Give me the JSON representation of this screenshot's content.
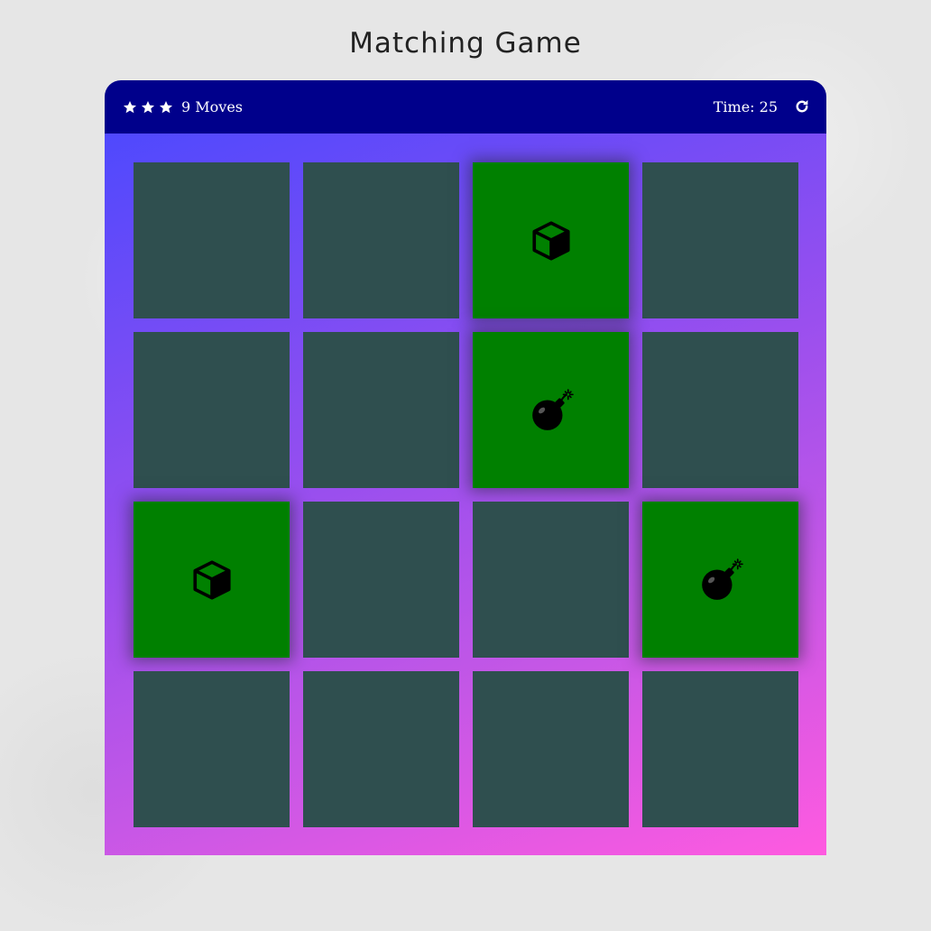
{
  "title": "Matching Game",
  "score_panel": {
    "stars": [
      "star-icon",
      "star-icon",
      "star-icon"
    ],
    "moves_text": "9 Moves",
    "timer_text": "Time: 25",
    "restart_icon": "restart-icon"
  },
  "deck": {
    "rows": 4,
    "columns": 4,
    "cards": [
      {
        "state": "closed",
        "icon": ""
      },
      {
        "state": "closed",
        "icon": ""
      },
      {
        "state": "open",
        "icon": "cube-icon"
      },
      {
        "state": "closed",
        "icon": ""
      },
      {
        "state": "closed",
        "icon": ""
      },
      {
        "state": "closed",
        "icon": ""
      },
      {
        "state": "open",
        "icon": "bomb-icon"
      },
      {
        "state": "closed",
        "icon": ""
      },
      {
        "state": "open",
        "icon": "cube-icon"
      },
      {
        "state": "closed",
        "icon": ""
      },
      {
        "state": "closed",
        "icon": ""
      },
      {
        "state": "open",
        "icon": "bomb-icon"
      },
      {
        "state": "closed",
        "icon": ""
      },
      {
        "state": "closed",
        "icon": ""
      },
      {
        "state": "closed",
        "icon": ""
      },
      {
        "state": "closed",
        "icon": ""
      }
    ]
  },
  "colors": {
    "header_background": "#00008b",
    "card_closed": "#2f4f4f",
    "card_open": "#008000",
    "deck_gradient_start": "#4f49fd",
    "deck_gradient_end": "#ff5ae0"
  }
}
